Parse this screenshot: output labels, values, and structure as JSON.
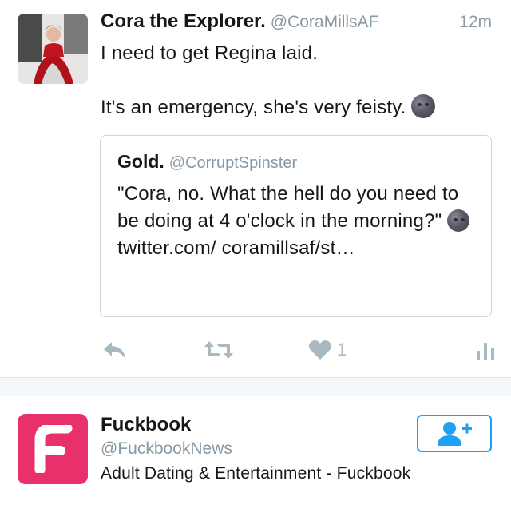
{
  "tweet": {
    "display_name": "Cora the Explorer.",
    "handle": "@CoraMillsAF",
    "time": "12m",
    "text_line1": "I need to get Regina laid.",
    "text_line2": "It's an emergency, she's very feisty.",
    "emoji": "new-moon-face-emoji"
  },
  "quote": {
    "display_name": "Gold.",
    "handle": "@CorruptSpinster",
    "text": "\"Cora, no. What the hell do you need to be doing at 4 o'clock in the morning?\"",
    "link": "twitter.com/ coramillsaf/st…"
  },
  "actions": {
    "reply_icon": "reply-icon",
    "retweet_icon": "retweet-icon",
    "like_icon": "heart-icon",
    "like_count": "1",
    "analytics_icon": "analytics-icon"
  },
  "suggestion": {
    "name": "Fuckbook",
    "handle": "@FuckbookNews",
    "bio": "Adult Dating & Entertainment - Fuckbook",
    "avatar_icon": "fuckbook-logo-icon",
    "follow_icon": "add-user-icon"
  },
  "colors": {
    "accent_blue": "#1da1f2",
    "muted": "#8899a6",
    "fuckbook_pink": "#e8306a"
  }
}
